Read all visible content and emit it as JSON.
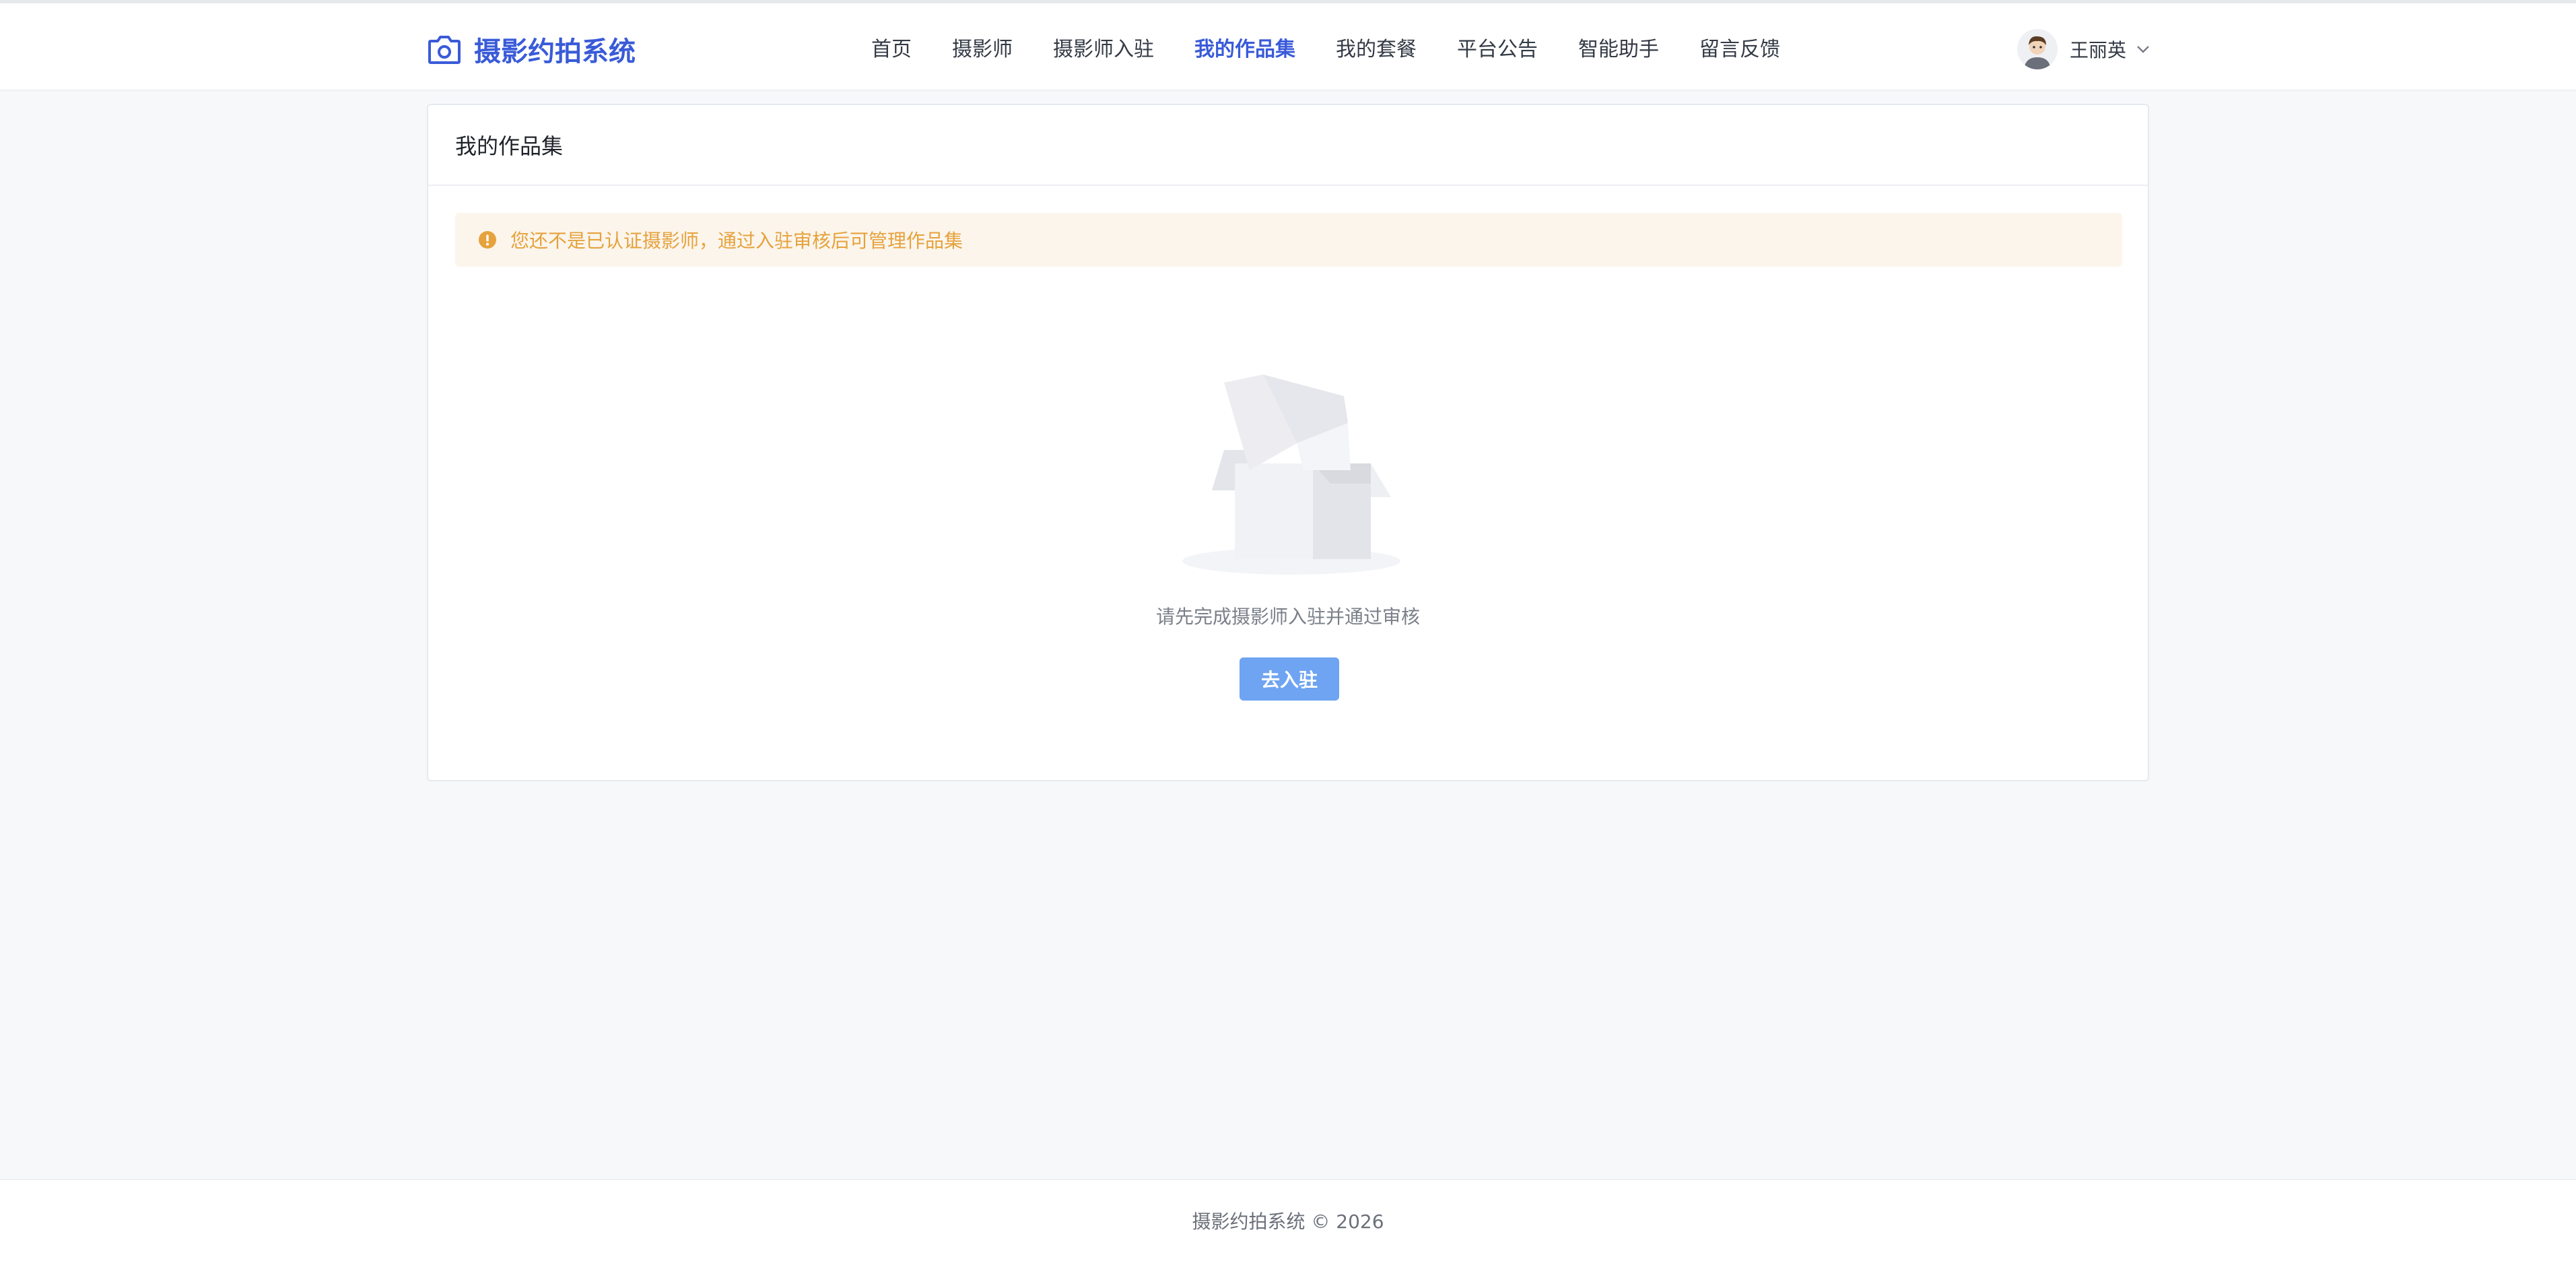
{
  "app": {
    "name": "摄影约拍系统",
    "brand_color": "#3a5bd8"
  },
  "header": {
    "logo_icon": "camera-icon",
    "nav": [
      {
        "label": "首页",
        "active": false
      },
      {
        "label": "摄影师",
        "active": false
      },
      {
        "label": "摄影师入驻",
        "active": false
      },
      {
        "label": "我的作品集",
        "active": true
      },
      {
        "label": "我的套餐",
        "active": false
      },
      {
        "label": "平台公告",
        "active": false
      },
      {
        "label": "智能助手",
        "active": false
      },
      {
        "label": "留言反馈",
        "active": false
      }
    ],
    "user": {
      "name": "王丽英",
      "avatar_icon": "avatar",
      "menu_icon": "chevron-down-icon"
    }
  },
  "main": {
    "card_title": "我的作品集",
    "alert": {
      "icon": "warning-icon",
      "text": "您还不是已认证摄影师，通过入驻审核后可管理作品集",
      "color": "#e6a23c"
    },
    "empty": {
      "icon": "empty-box-icon",
      "text": "请先完成摄影师入驻并通过审核"
    },
    "action_button": {
      "label": "去入驻",
      "color": "#6ea4f2"
    }
  },
  "footer": {
    "text": "摄影约拍系统 © 2026"
  }
}
